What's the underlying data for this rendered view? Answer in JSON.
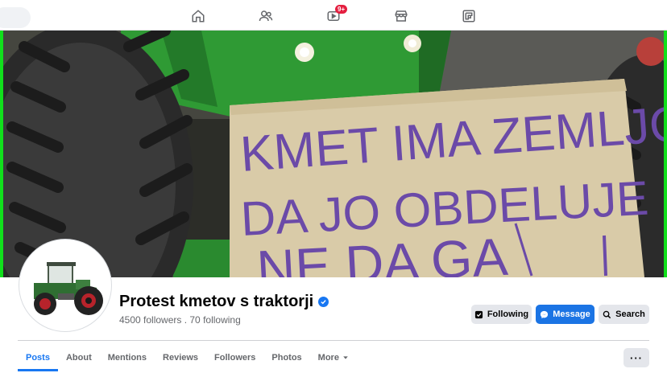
{
  "nav": {
    "items": [
      {
        "name": "home-icon"
      },
      {
        "name": "friends-icon"
      },
      {
        "name": "watch-icon",
        "badge": "9+"
      },
      {
        "name": "marketplace-icon"
      },
      {
        "name": "gaming-icon"
      }
    ]
  },
  "cover": {
    "sign_lines": [
      "KMET IMA ZEMLJO",
      "DA JO OBDELUJE",
      "NE DA GA"
    ]
  },
  "profile": {
    "name": "Protest kmetov s traktorji",
    "followers_line": "4500 followers . 70 following"
  },
  "actions": {
    "following": "Following",
    "message": "Message",
    "search": "Search"
  },
  "tabs": [
    {
      "label": "Posts",
      "active": true
    },
    {
      "label": "About"
    },
    {
      "label": "Mentions"
    },
    {
      "label": "Reviews"
    },
    {
      "label": "Followers"
    },
    {
      "label": "Photos"
    },
    {
      "label": "More"
    }
  ],
  "more_menu": "···",
  "colors": {
    "accent": "#1877f2",
    "badge": "#e41e3f",
    "cover_edge": "#11e01c",
    "tractor_green": "#2f9a34"
  }
}
